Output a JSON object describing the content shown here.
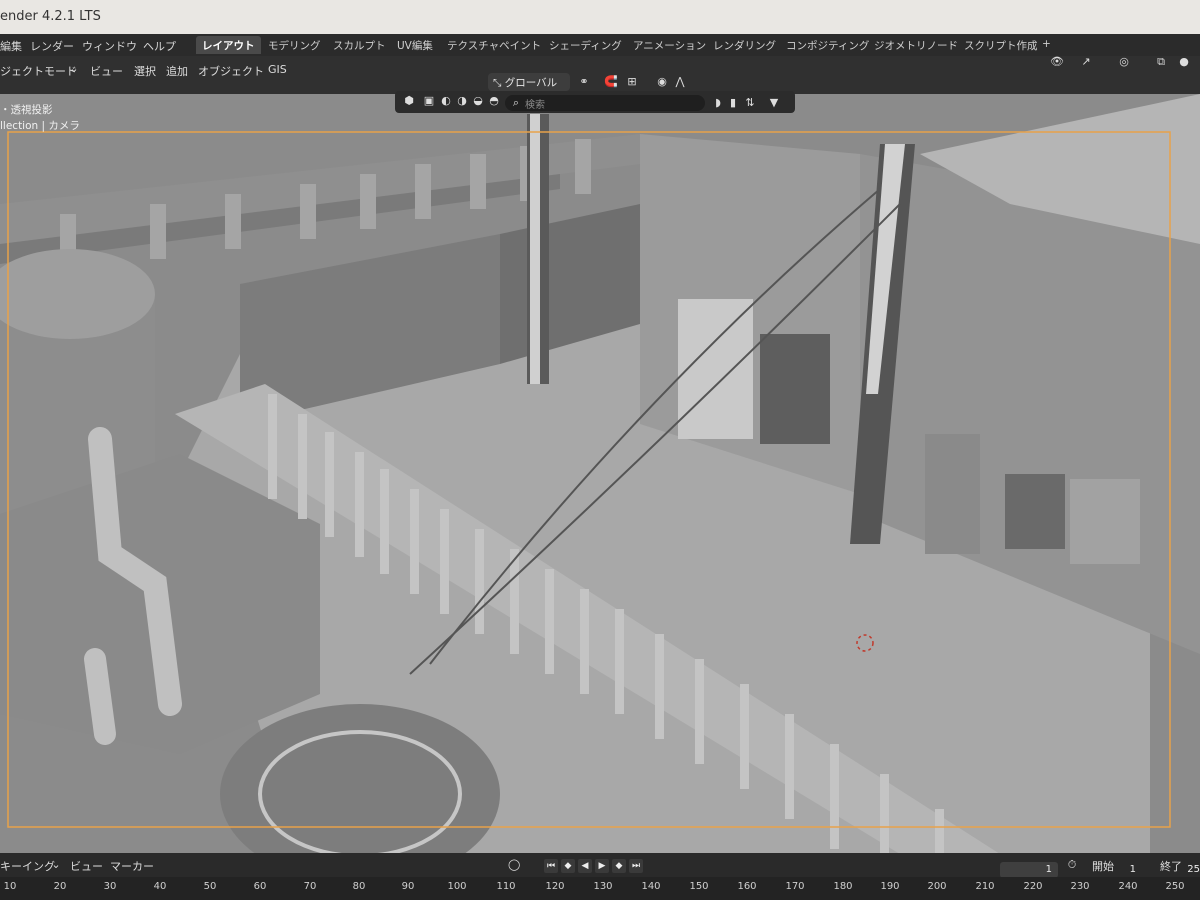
{
  "window": {
    "title": "ender 4.2.1 LTS"
  },
  "menu": {
    "items": [
      "編集",
      "レンダー",
      "ウィンドウ",
      "ヘルプ"
    ],
    "workspaces": [
      {
        "label": "レイアウト",
        "active": true
      },
      {
        "label": "モデリング",
        "active": false
      },
      {
        "label": "スカルプト",
        "active": false
      },
      {
        "label": "UV編集",
        "active": false
      },
      {
        "label": "テクスチャペイント",
        "active": false
      },
      {
        "label": "シェーディング",
        "active": false
      },
      {
        "label": "アニメーション",
        "active": false
      },
      {
        "label": "レンダリング",
        "active": false
      },
      {
        "label": "コンポジティング",
        "active": false
      },
      {
        "label": "ジオメトリノード",
        "active": false
      },
      {
        "label": "スクリプト作成",
        "active": false
      }
    ],
    "add_workspace": "+"
  },
  "header": {
    "mode": "ジェクトモード",
    "menus": [
      "ビュー",
      "選択",
      "追加",
      "オブジェクト",
      "GIS"
    ],
    "transform_orientation": "グローバル",
    "search_placeholder": "検索"
  },
  "viewport": {
    "overlay_view": "・透視投影",
    "overlay_collection": "llection | カメラ"
  },
  "timeline": {
    "menus": [
      "キーイング",
      "ビュー",
      "マーカー"
    ],
    "current_frame": "1",
    "start_label": "開始",
    "start_value": "1",
    "end_label": "終了",
    "end_value": "25",
    "ticks": [
      "10",
      "20",
      "30",
      "40",
      "50",
      "60",
      "70",
      "80",
      "90",
      "100",
      "110",
      "120",
      "130",
      "140",
      "150",
      "160",
      "170",
      "180",
      "190",
      "200",
      "210",
      "220",
      "230",
      "240",
      "250"
    ]
  },
  "colors": {
    "camera_frame": "#e8a24a",
    "ui_dark": "#2b2b2b",
    "scene_clay": "#9a9a9a"
  }
}
